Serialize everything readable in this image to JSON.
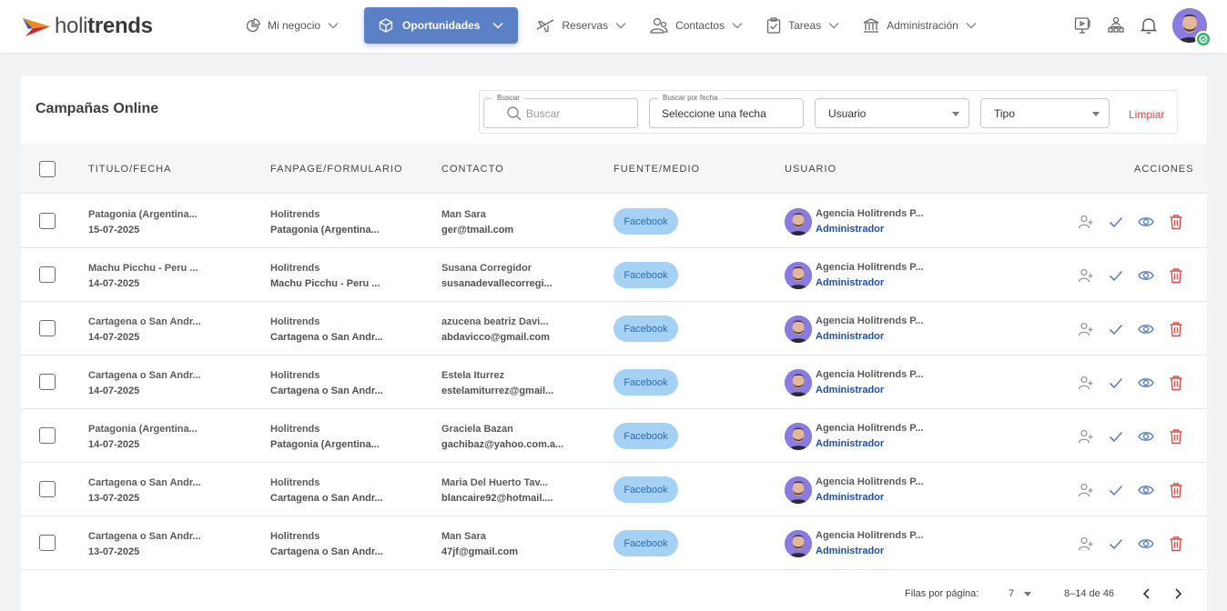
{
  "app": {
    "logo_prefix": "holi",
    "logo_suffix": "trends"
  },
  "nav": {
    "items": [
      {
        "label": "Mi negocio"
      },
      {
        "label": "Oportunidades"
      },
      {
        "label": "Reservas"
      },
      {
        "label": "Contactos"
      },
      {
        "label": "Tareas"
      },
      {
        "label": "Administración"
      }
    ]
  },
  "page": {
    "title": "Campañas Online"
  },
  "filters": {
    "search_legend": "Buscar",
    "search_placeholder": "Buscar",
    "date_legend": "Buscar por fecha",
    "date_value": "Seleccione una fecha",
    "user_value": "Usuario",
    "type_value": "Tipo",
    "clear_label": "Limpiar"
  },
  "table": {
    "headers": [
      "TITULO/FECHA",
      "FANPAGE/FORMULARIO",
      "CONTACTO",
      "FUENTE/MEDIO",
      "USUARIO",
      "ACCIONES"
    ],
    "rows": [
      {
        "title": "Patagonia (Argentina...",
        "date": "15-07-2025",
        "fanpage": "Holitrends",
        "form": "Patagonia (Argentina...",
        "contact_name": "Man Sara",
        "contact_email": "ger@tmail.com",
        "source": "Facebook",
        "user": "Agencia Holitrends P...",
        "role": "Administrador"
      },
      {
        "title": "Machu Picchu - Peru ...",
        "date": "14-07-2025",
        "fanpage": "Holitrends",
        "form": "Machu Picchu - Peru ...",
        "contact_name": "Susana Corregidor",
        "contact_email": "susanadevallecorregi...",
        "source": "Facebook",
        "user": "Agencia Holitrends P...",
        "role": "Administrador"
      },
      {
        "title": "Cartagena o San Andr...",
        "date": "14-07-2025",
        "fanpage": "Holitrends",
        "form": "Cartagena o San Andr...",
        "contact_name": "azucena beatriz Davi...",
        "contact_email": "abdavicco@gmail.com",
        "source": "Facebook",
        "user": "Agencia Holitrends P...",
        "role": "Administrador"
      },
      {
        "title": "Cartagena o San Andr...",
        "date": "14-07-2025",
        "fanpage": "Holitrends",
        "form": "Cartagena o San Andr...",
        "contact_name": "Estela Iturrez",
        "contact_email": "estelamiturrez@gmail...",
        "source": "Facebook",
        "user": "Agencia Holitrends P...",
        "role": "Administrador"
      },
      {
        "title": "Patagonia (Argentina...",
        "date": "14-07-2025",
        "fanpage": "Holitrends",
        "form": "Patagonia (Argentina...",
        "contact_name": "Graciela Bazan",
        "contact_email": "gachibaz@yahoo.com.a...",
        "source": "Facebook",
        "user": "Agencia Holitrends P...",
        "role": "Administrador"
      },
      {
        "title": "Cartagena o San Andr...",
        "date": "13-07-2025",
        "fanpage": "Holitrends",
        "form": "Cartagena o San Andr...",
        "contact_name": "Maria Del Huerto Tav...",
        "contact_email": "blancaire92@hotmail....",
        "source": "Facebook",
        "user": "Agencia Holitrends P...",
        "role": "Administrador"
      },
      {
        "title": "Cartagena o San Andr...",
        "date": "13-07-2025",
        "fanpage": "Holitrends",
        "form": "Cartagena o San Andr...",
        "contact_name": "Man Sara",
        "contact_email": "47jf@gmail.com",
        "source": "Facebook",
        "user": "Agencia Holitrends P...",
        "role": "Administrador"
      }
    ]
  },
  "pagination": {
    "rows_label": "Filas por página:",
    "rows_value": "7",
    "range": "8–14 de 46"
  },
  "colors": {
    "accent": "#5b80c6",
    "chip_bg": "#a5d1f5",
    "danger": "#e04848",
    "role": "#1f4fa8"
  }
}
